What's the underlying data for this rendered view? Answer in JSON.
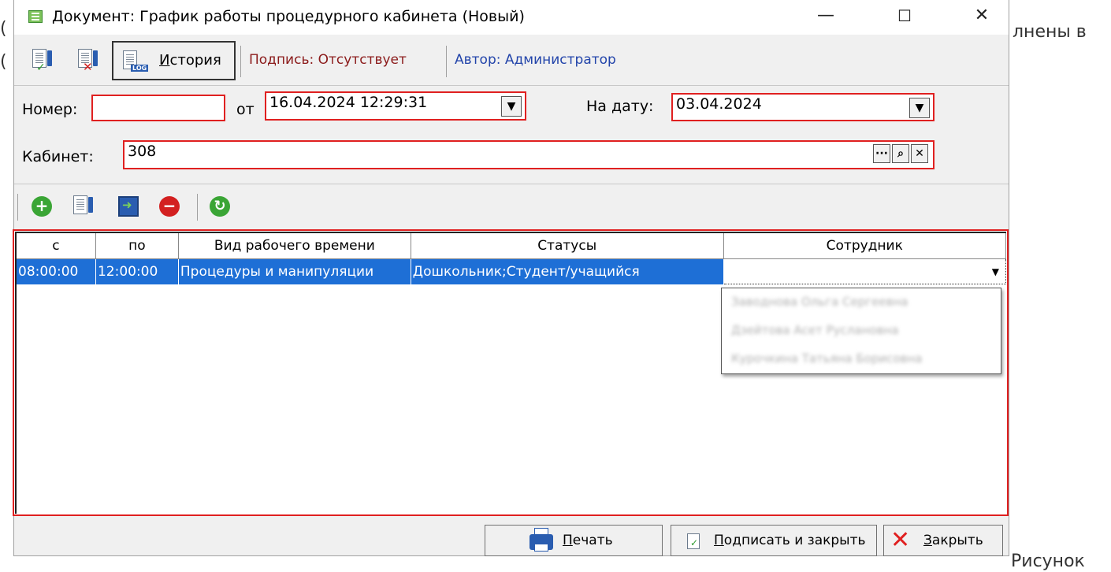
{
  "background": {
    "text_right_top": "лнены в",
    "text_right_bottom": "Рисунок",
    "left_frag_1": "(",
    "left_frag_2": "("
  },
  "window": {
    "title": "Документ: График работы процедурного кабинета (Новый)",
    "controls": {
      "minimize": "—",
      "maximize": "☐",
      "close": "✕"
    }
  },
  "toolbar": {
    "history_label_first": "И",
    "history_label_rest": "стория",
    "log_tag": "LOG",
    "signature": "Подпись: Отсутствует",
    "author": "Автор: Администратор"
  },
  "form": {
    "number_label": "Номер:",
    "number_value": "",
    "from_label": "от",
    "from_value": "16.04.2024 12:29:31",
    "on_date_label": "На дату:",
    "on_date_value": "03.04.2024",
    "cabinet_label": "Кабинет:",
    "cabinet_value": "308"
  },
  "grid": {
    "columns": [
      "с",
      "по",
      "Вид рабочего времени",
      "Статусы",
      "Сотрудник"
    ],
    "rows": [
      {
        "from": "08:00:00",
        "to": "12:00:00",
        "work_type": "Процедуры и манипуляции",
        "statuses": "Дошкольник;Студент/учащийся",
        "employee": ""
      }
    ],
    "employee_dropdown": [
      "Заводнова Ольга Сергеевна",
      "Дзейтова Асет Руслановна",
      "Курочкина Татьяна Борисовна"
    ]
  },
  "footer": {
    "print_first": "П",
    "print_rest": "ечать",
    "sign_close_first": "П",
    "sign_close_rest": "одписать и закрыть",
    "close_first": "З",
    "close_rest": "акрыть"
  },
  "colors": {
    "accent_red": "#e02020",
    "selection_blue": "#1e6fd6",
    "link_blue": "#2244aa",
    "signature_red": "#8b1a1a"
  }
}
